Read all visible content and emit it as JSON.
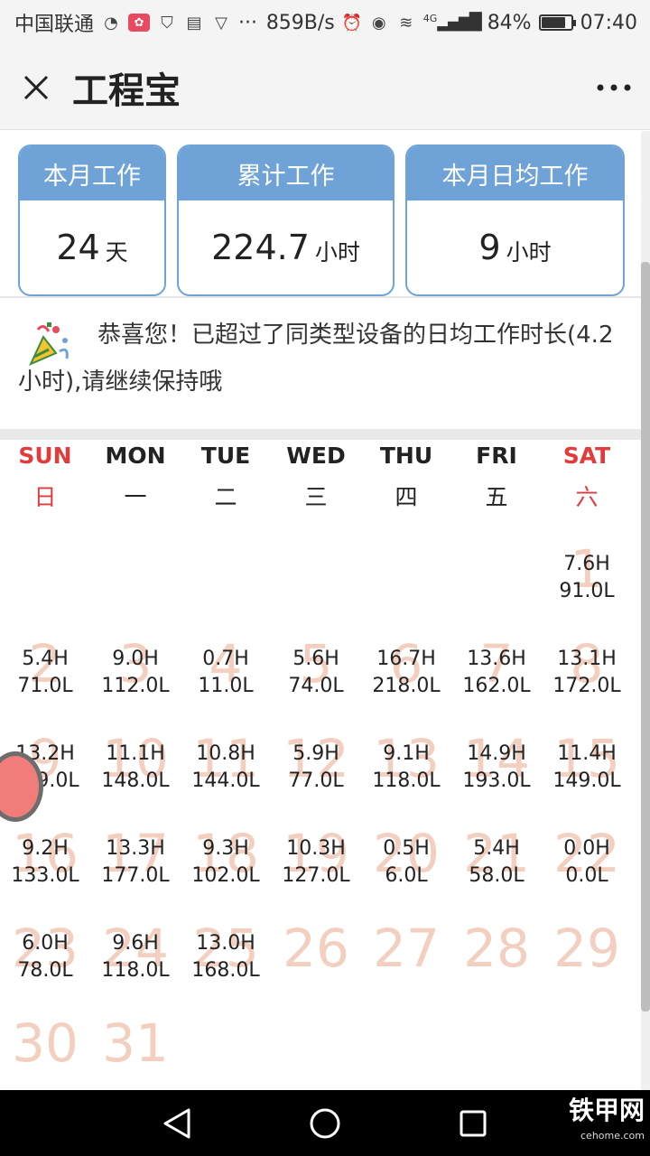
{
  "status_bar": {
    "carrier": "中国联通",
    "net_speed": "859B/s",
    "signal_label": "4G",
    "battery": "84%",
    "battery_level": 0.84,
    "time": "07:40",
    "more": "···"
  },
  "header": {
    "title": "工程宝",
    "close_icon": "close-icon",
    "more_icon": "more-dots-icon"
  },
  "stats": [
    {
      "label": "本月工作",
      "value": "24",
      "unit": "天"
    },
    {
      "label": "累计工作",
      "value": "224.7",
      "unit": "小时"
    },
    {
      "label": "本月日均工作",
      "value": "9",
      "unit": "小时"
    }
  ],
  "congrats": {
    "icon": "party-popper-icon",
    "text": "恭喜您！已超过了同类型设备的日均工作时长(4.2小时),请继续保持哦"
  },
  "calendar": {
    "weekdays": [
      {
        "en": "SUN",
        "cn": "日"
      },
      {
        "en": "MON",
        "cn": "一"
      },
      {
        "en": "TUE",
        "cn": "二"
      },
      {
        "en": "WED",
        "cn": "三"
      },
      {
        "en": "THU",
        "cn": "四"
      },
      {
        "en": "FRI",
        "cn": "五"
      },
      {
        "en": "SAT",
        "cn": "六"
      }
    ],
    "weeks": [
      [
        null,
        null,
        null,
        null,
        null,
        null,
        {
          "day": "1",
          "hours": "7.6H",
          "liters": "91.0L"
        }
      ],
      [
        {
          "day": "2",
          "hours": "5.4H",
          "liters": "71.0L"
        },
        {
          "day": "3",
          "hours": "9.0H",
          "liters": "112.0L"
        },
        {
          "day": "4",
          "hours": "0.7H",
          "liters": "11.0L"
        },
        {
          "day": "5",
          "hours": "5.6H",
          "liters": "74.0L"
        },
        {
          "day": "6",
          "hours": "16.7H",
          "liters": "218.0L"
        },
        {
          "day": "7",
          "hours": "13.6H",
          "liters": "162.0L"
        },
        {
          "day": "8",
          "hours": "13.1H",
          "liters": "172.0L"
        }
      ],
      [
        {
          "day": "9",
          "hours": "13.2H",
          "liters": "169.0L"
        },
        {
          "day": "10",
          "hours": "11.1H",
          "liters": "148.0L"
        },
        {
          "day": "11",
          "hours": "10.8H",
          "liters": "144.0L"
        },
        {
          "day": "12",
          "hours": "5.9H",
          "liters": "77.0L"
        },
        {
          "day": "13",
          "hours": "9.1H",
          "liters": "118.0L"
        },
        {
          "day": "14",
          "hours": "14.9H",
          "liters": "193.0L"
        },
        {
          "day": "15",
          "hours": "11.4H",
          "liters": "149.0L"
        }
      ],
      [
        {
          "day": "16",
          "hours": "9.2H",
          "liters": "133.0L"
        },
        {
          "day": "17",
          "hours": "13.3H",
          "liters": "177.0L"
        },
        {
          "day": "18",
          "hours": "9.3H",
          "liters": "102.0L"
        },
        {
          "day": "19",
          "hours": "10.3H",
          "liters": "127.0L"
        },
        {
          "day": "20",
          "hours": "0.5H",
          "liters": "6.0L"
        },
        {
          "day": "21",
          "hours": "5.4H",
          "liters": "58.0L"
        },
        {
          "day": "22",
          "hours": "0.0H",
          "liters": "0.0L"
        }
      ],
      [
        {
          "day": "23",
          "hours": "6.0H",
          "liters": "78.0L"
        },
        {
          "day": "24",
          "hours": "9.6H",
          "liters": "118.0L"
        },
        {
          "day": "25",
          "hours": "13.0H",
          "liters": "168.0L"
        },
        {
          "day": "26"
        },
        {
          "day": "27"
        },
        {
          "day": "28"
        },
        {
          "day": "29"
        }
      ],
      [
        {
          "day": "30"
        },
        {
          "day": "31"
        },
        null,
        null,
        null,
        null,
        null
      ]
    ]
  },
  "nav": {
    "back_icon": "back-triangle-icon",
    "home_icon": "home-circle-icon",
    "recents_icon": "recents-square-icon"
  },
  "watermark": {
    "main": "铁甲网",
    "sub": "cehome.com"
  },
  "colors": {
    "accent": "#6fa3d8",
    "weekend": "#e23b3b",
    "day_number": "#f3cfc0"
  }
}
